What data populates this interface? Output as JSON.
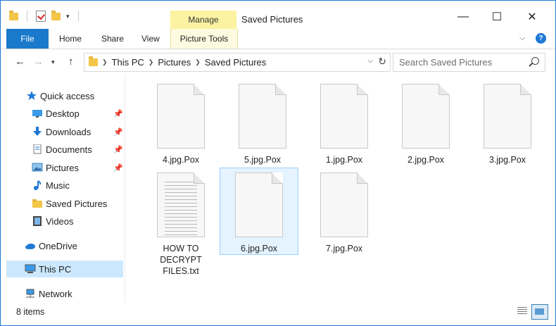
{
  "title_bar": {
    "manage_tab": "Manage",
    "window_title": "Saved Pictures",
    "minimize": "—",
    "maximize": "☐",
    "close": "✕"
  },
  "ribbon": {
    "tabs": [
      "File",
      "Home",
      "Share",
      "View",
      "Picture Tools"
    ],
    "help": "?"
  },
  "address": {
    "breadcrumb": [
      "This PC",
      "Pictures",
      "Saved Pictures"
    ],
    "search_placeholder": "Search Saved Pictures"
  },
  "sidebar": {
    "items": [
      {
        "label": "Quick access",
        "icon": "star-icon"
      },
      {
        "label": "Desktop",
        "icon": "desktop-icon"
      },
      {
        "label": "Downloads",
        "icon": "download-icon"
      },
      {
        "label": "Documents",
        "icon": "documents-icon"
      },
      {
        "label": "Pictures",
        "icon": "pictures-icon"
      },
      {
        "label": "Music",
        "icon": "music-icon"
      },
      {
        "label": "Saved Pictures",
        "icon": "folder-icon"
      },
      {
        "label": "Videos",
        "icon": "videos-icon"
      },
      {
        "label": "OneDrive",
        "icon": "cloud-icon"
      },
      {
        "label": "This PC",
        "icon": "computer-icon"
      },
      {
        "label": "Network",
        "icon": "network-icon"
      }
    ]
  },
  "files": [
    {
      "name": "4.jpg.Pox"
    },
    {
      "name": "5.jpg.Pox"
    },
    {
      "name": "1.jpg.Pox"
    },
    {
      "name": "2.jpg.Pox"
    },
    {
      "name": "3.jpg.Pox"
    },
    {
      "name": "HOW TO DECRYPT FILES.txt"
    },
    {
      "name": "6.jpg.Pox"
    },
    {
      "name": "7.jpg.Pox"
    }
  ],
  "status": {
    "item_count": "8 items"
  },
  "colors": {
    "accent": "#1979ca",
    "manage_tab": "#fcf3a2",
    "selection": "#cce8ff"
  }
}
